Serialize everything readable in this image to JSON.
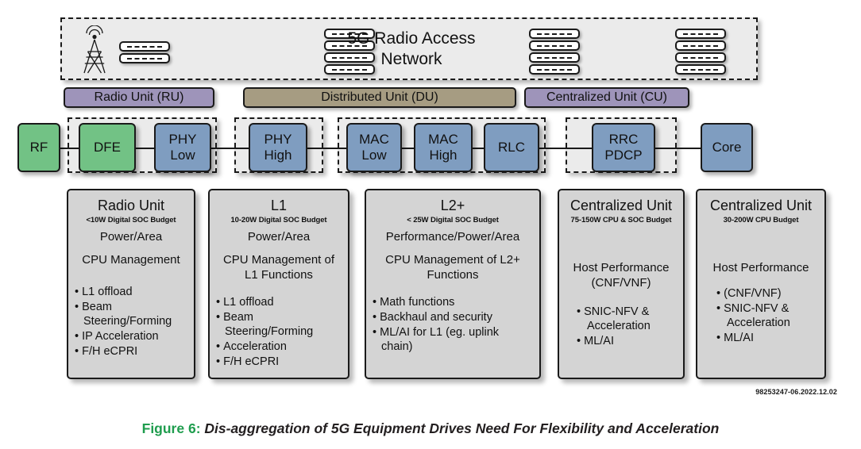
{
  "banner": {
    "title": "5G Radio Access Network",
    "icons": {
      "tower": "antenna-tower-icon",
      "server_a": "server-stack-icon",
      "server_b": "server-stack-icon",
      "server_c": "server-stack-icon",
      "server_d": "server-stack-icon"
    }
  },
  "unit_bars": [
    {
      "label": "Radio Unit (RU)",
      "color": "#9e94ba"
    },
    {
      "label": "Distributed Unit (DU)",
      "color": "#a69c82"
    },
    {
      "label": "Centralized Unit (CU)",
      "color": "#9e94ba"
    }
  ],
  "chain": [
    {
      "label": "RF",
      "color": "#72c285"
    },
    {
      "label": "DFE",
      "color": "#72c285"
    },
    {
      "label": "PHY Low",
      "color": "#7f9dc0"
    },
    {
      "label": "PHY High",
      "color": "#7f9dc0"
    },
    {
      "label": "MAC Low",
      "color": "#7f9dc0"
    },
    {
      "label": "MAC High",
      "color": "#7f9dc0"
    },
    {
      "label": "RLC",
      "color": "#7f9dc0"
    },
    {
      "label": "RRC PDCP",
      "color": "#7f9dc0"
    },
    {
      "label": "Core",
      "color": "#7f9dc0"
    }
  ],
  "chain_labels": {
    "rf": "RF",
    "dfe": "DFE",
    "phy_low_1": "PHY",
    "phy_low_2": "Low",
    "phy_high_1": "PHY",
    "phy_high_2": "High",
    "mac_low_1": "MAC",
    "mac_low_2": "Low",
    "mac_high_1": "MAC",
    "mac_high_2": "High",
    "rlc": "RLC",
    "rrc_1": "RRC",
    "rrc_2": "PDCP",
    "core": "Core"
  },
  "cards": [
    {
      "title": "Radio Unit",
      "budget": "<10W Digital SOC Budget",
      "focus": "Power/Area",
      "role": "CPU Management",
      "items": [
        "L1 offload",
        "Beam Steering/Forming",
        "IP Acceleration",
        "F/H eCPRI"
      ]
    },
    {
      "title": "L1",
      "budget": "10-20W Digital SOC Budget",
      "focus": "Power/Area",
      "role": "CPU Management of L1 Functions",
      "items": [
        "L1 offload",
        "Beam Steering/Forming",
        "Acceleration",
        "F/H eCPRI"
      ]
    },
    {
      "title": "L2+",
      "budget": "< 25W Digital SOC Budget",
      "focus": "Performance/Power/Area",
      "role": "CPU Management of L2+ Functions",
      "items": [
        "Math functions",
        "Backhaul and security",
        "ML/AI for L1 (eg. uplink chain)"
      ]
    },
    {
      "title": "Centralized Unit",
      "budget": "75-150W CPU & SOC Budget",
      "focus": "",
      "role": "Host Performance (CNF/VNF)",
      "items": [
        "SNIC-NFV & Acceleration",
        "ML/AI"
      ]
    },
    {
      "title": "Centralized Unit",
      "budget": "30-200W CPU Budget",
      "focus": "",
      "role": "Host Performance",
      "items": [
        "(CNF/VNF)",
        "SNIC-NFV & Acceleration",
        "ML/AI"
      ]
    }
  ],
  "doc_code": "98253247-06.2022.12.02",
  "caption": {
    "number": "Figure 6:",
    "text": " Dis-aggregation of 5G Equipment Drives Need For Flexibility and Acceleration",
    "number_color": "#1f9d4e"
  }
}
